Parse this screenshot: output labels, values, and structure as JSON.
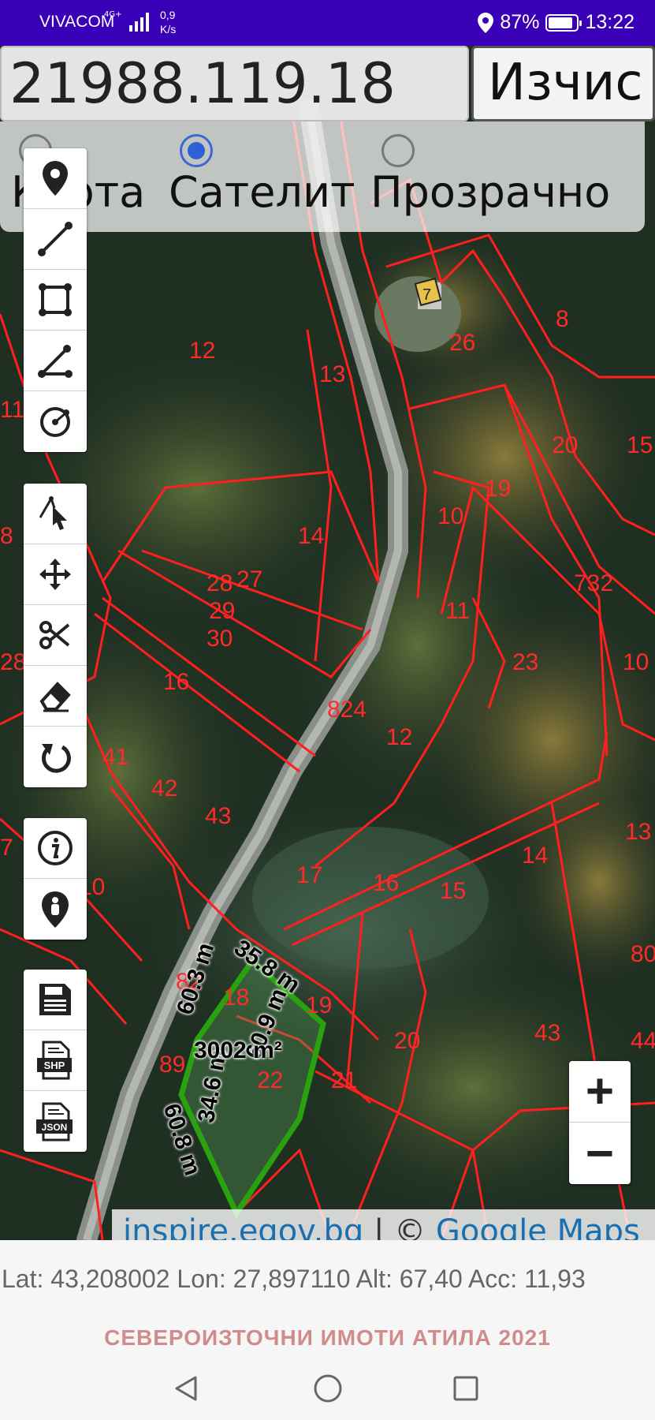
{
  "status": {
    "carrier": "VIVACOM",
    "network": "4G+",
    "speed_value": "0,9",
    "speed_unit": "K/s",
    "battery": "87%",
    "battery_level": 0.87,
    "time": "13:22"
  },
  "search": {
    "id_value": "21988.119.18",
    "calc_label": "Изчис"
  },
  "layers": {
    "options": [
      "Карта",
      "Сателит",
      "Прозрачно"
    ],
    "selected": "Сателит"
  },
  "toolbar": {
    "groups": [
      [
        "point-icon",
        "line-icon",
        "polygon-icon",
        "angle-icon",
        "circle-icon"
      ],
      [
        "select-icon",
        "move-icon",
        "cut-icon",
        "eraser-icon",
        "undo-icon"
      ],
      [
        "info-icon",
        "location-person-icon"
      ],
      [
        "save-icon",
        "shp-export-icon",
        "json-export-icon"
      ]
    ],
    "shp_label": "SHP",
    "json_label": "JSON"
  },
  "map": {
    "parcel_labels": [
      "12",
      "13",
      "11",
      "8",
      "26",
      "8",
      "20",
      "15",
      "19",
      "14",
      "10",
      "28",
      "27",
      "29",
      "30",
      "11",
      "732",
      "23",
      "10",
      "28",
      "16",
      "824",
      "12",
      "41",
      "42",
      "43",
      "13",
      "17",
      "16",
      "15",
      "14",
      "10",
      "82",
      "18",
      "19",
      "20",
      "43",
      "89",
      "22",
      "21",
      "80",
      "44",
      "2",
      "7"
    ],
    "measurements": {
      "side_top": "35.8 m",
      "side_left": "60.3 m",
      "side_right": "60.9 m",
      "side_bottom": "60.8 m",
      "side_bottom2": "34.6 m",
      "area": "3002 m²"
    },
    "line_color": "#ff1f1f",
    "selected_color": "#2aa10f"
  },
  "zoom": {
    "in": "+",
    "out": "−"
  },
  "attribution": {
    "source1": "inspire.egov.bg",
    "sep": " | © ",
    "source2": "Google Maps"
  },
  "info": {
    "coords": "Lat: 43,208002 Lon: 27,897110 Alt: 67,40 Acc: 11,93",
    "brand": "СЕВЕРОИЗТОЧНИ ИМОТИ АТИЛА 2021"
  }
}
